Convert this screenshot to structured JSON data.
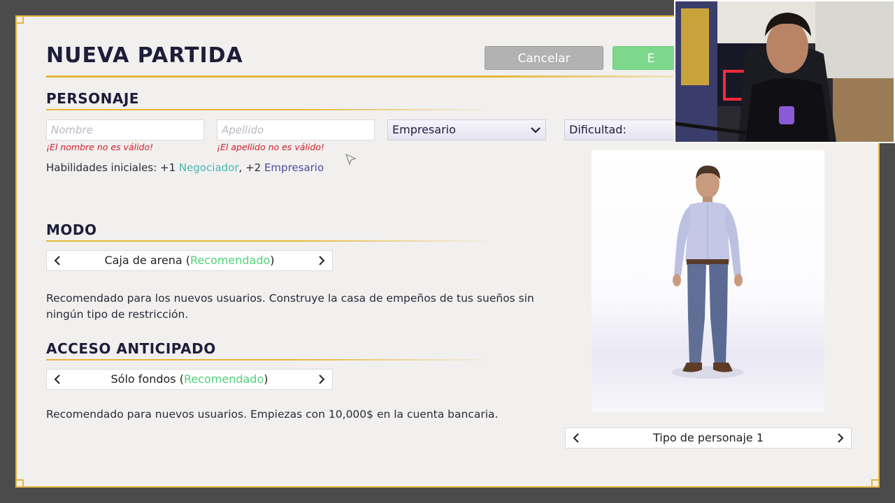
{
  "dialog": {
    "title": "NUEVA PARTIDA",
    "cancel_label": "Cancelar",
    "confirm_label": "E"
  },
  "personaje": {
    "heading": "PERSONAJE",
    "first_name": {
      "value": "",
      "placeholder": "Nombre",
      "error": "¡El nombre no es válido!"
    },
    "last_name": {
      "value": "",
      "placeholder": "Apellido",
      "error": "¡El apellido no es válido!"
    },
    "background_select": "Empresario",
    "difficulty_label": "Dificultad:",
    "skills": {
      "prefix": "Habilidades iniciales: +1 ",
      "skill1": "Negociador",
      "middle": ", +2 ",
      "skill2": "Empresario"
    }
  },
  "modo": {
    "heading": "MODO",
    "value": "Caja de arena (",
    "tag": "Recomendado",
    "suffix": ")",
    "description": "Recomendado para los nuevos usuarios. Construye la casa de empeños de tus sueños sin ningún tipo de restricción."
  },
  "acceso": {
    "heading": "ACCESO ANTICIPADO",
    "value": "Sólo fondos (",
    "tag": "Recomendado",
    "suffix": ")",
    "description": "Recomendado para nuevos usuarios. Empiezas con 10,000$ en la cuenta bancaria."
  },
  "character_type": "Tipo de personaje 1",
  "icons": {
    "left_arrow": "chevron-left-icon",
    "right_arrow": "chevron-right-icon",
    "dropdown": "chevron-down-icon"
  },
  "colors": {
    "accent": "#e6b532",
    "title": "#1e1d3a",
    "error": "#d01c2a",
    "recommended": "#4fd27a",
    "skill_teal": "#49b6b4",
    "skill_purple": "#4d4aa0",
    "cancel_button": "#b2b2b2",
    "confirm_button": "#7ed88c"
  }
}
